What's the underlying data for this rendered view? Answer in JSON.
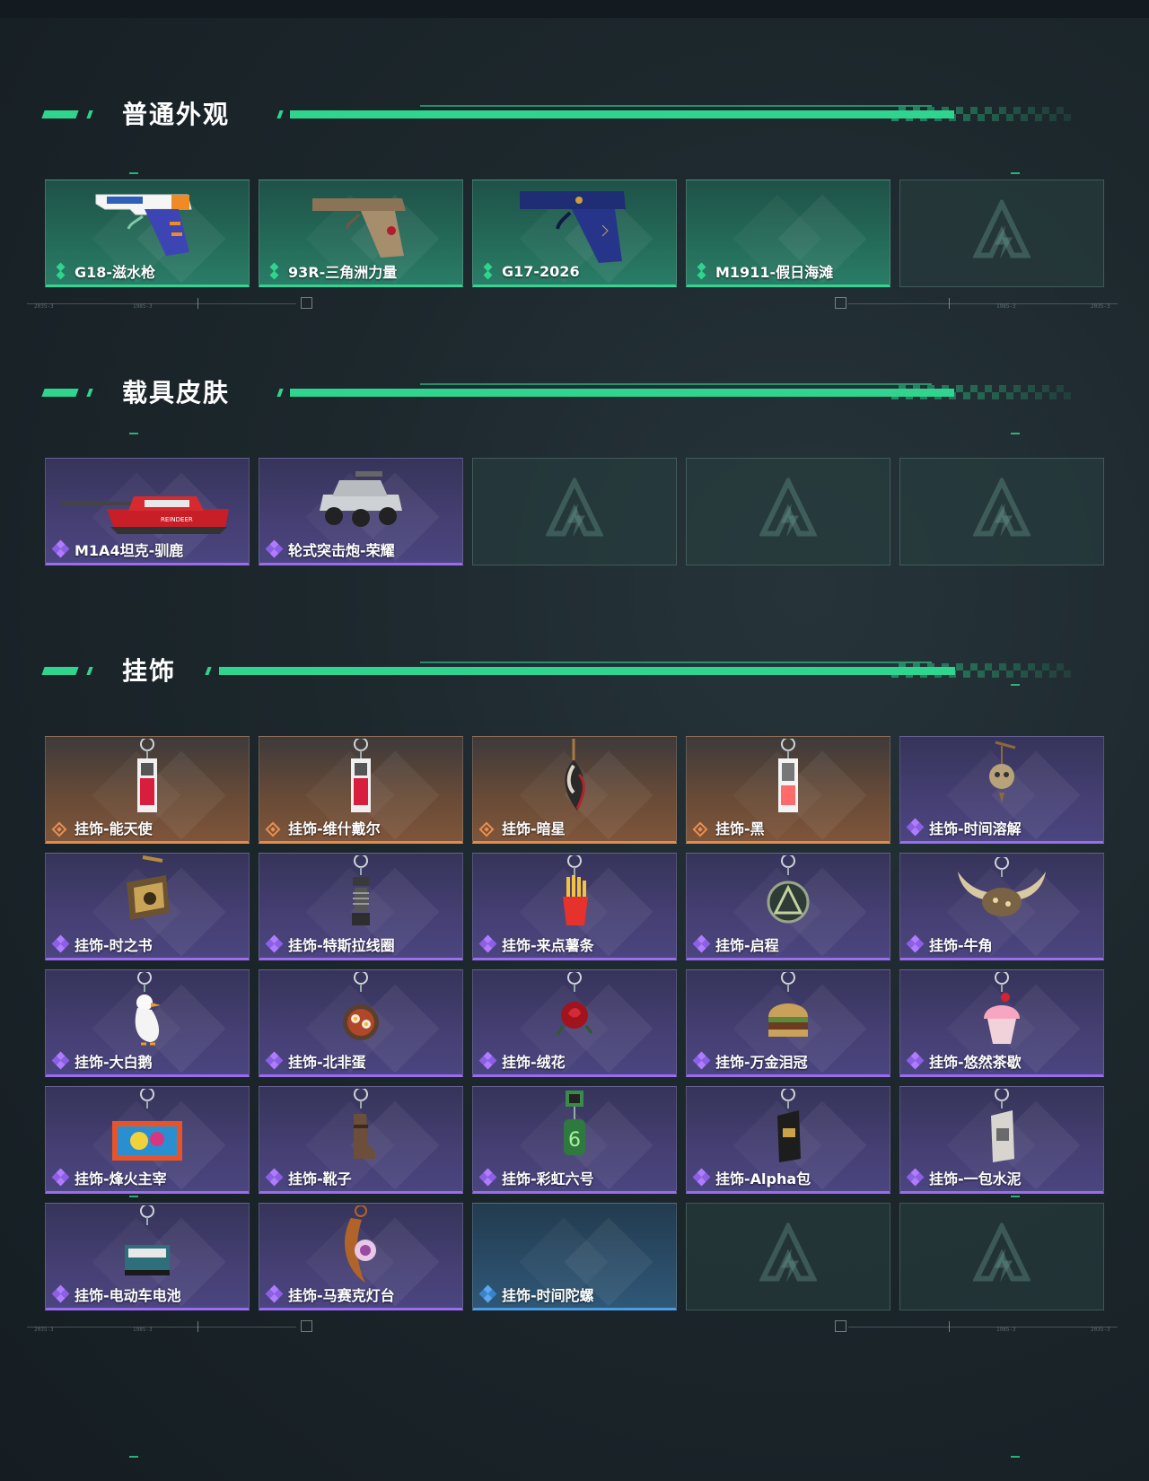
{
  "sections": [
    {
      "title": "普通外观",
      "cards": [
        {
          "label": "G18-滋水枪",
          "rarity": "green",
          "item": "pistol-orange"
        },
        {
          "label": "93R-三角洲力量",
          "rarity": "green",
          "item": "pistol-tan"
        },
        {
          "label": "G17-2026",
          "rarity": "green",
          "item": "pistol-navy"
        },
        {
          "label": "M1911-假日海滩",
          "rarity": "green",
          "item": "none"
        },
        {
          "label": "",
          "rarity": "empty",
          "item": "logo"
        }
      ]
    },
    {
      "title": "载具皮肤",
      "cards": [
        {
          "label": "M1A4坦克-驯鹿",
          "rarity": "purple",
          "item": "tank"
        },
        {
          "label": "轮式突击炮-荣耀",
          "rarity": "purple",
          "item": "armored-car"
        },
        {
          "label": "",
          "rarity": "empty",
          "item": "logo"
        },
        {
          "label": "",
          "rarity": "empty",
          "item": "logo"
        },
        {
          "label": "",
          "rarity": "empty",
          "item": "logo"
        }
      ]
    },
    {
      "title": "挂饰",
      "cards": [
        {
          "label": "挂饰-能天使",
          "rarity": "orange",
          "item": "charm-card-red"
        },
        {
          "label": "挂饰-维什戴尔",
          "rarity": "orange",
          "item": "charm-card-red"
        },
        {
          "label": "挂饰-暗星",
          "rarity": "orange",
          "item": "charm-feather"
        },
        {
          "label": "挂饰-黑",
          "rarity": "orange",
          "item": "charm-card-white"
        },
        {
          "label": "挂饰-时间溶解",
          "rarity": "purple",
          "item": "charm-skull"
        },
        {
          "label": "挂饰-时之书",
          "rarity": "purple",
          "item": "charm-book"
        },
        {
          "label": "挂饰-特斯拉线圈",
          "rarity": "purple",
          "item": "charm-coil"
        },
        {
          "label": "挂饰-来点薯条",
          "rarity": "purple",
          "item": "charm-fries"
        },
        {
          "label": "挂饰-启程",
          "rarity": "purple",
          "item": "charm-medal"
        },
        {
          "label": "挂饰-牛角",
          "rarity": "purple",
          "item": "charm-horns"
        },
        {
          "label": "挂饰-大白鹅",
          "rarity": "purple",
          "item": "charm-goose"
        },
        {
          "label": "挂饰-北非蛋",
          "rarity": "purple",
          "item": "charm-pan"
        },
        {
          "label": "挂饰-绒花",
          "rarity": "purple",
          "item": "charm-rose"
        },
        {
          "label": "挂饰-万金泪冠",
          "rarity": "purple",
          "item": "charm-burger"
        },
        {
          "label": "挂饰-悠然茶歇",
          "rarity": "purple",
          "item": "charm-cupcake"
        },
        {
          "label": "挂饰-烽火主宰",
          "rarity": "purple",
          "item": "charm-banner"
        },
        {
          "label": "挂饰-靴子",
          "rarity": "purple",
          "item": "charm-boot"
        },
        {
          "label": "挂饰-彩虹六号",
          "rarity": "purple",
          "item": "charm-six"
        },
        {
          "label": "挂饰-Alpha包",
          "rarity": "purple",
          "item": "charm-bag-dark"
        },
        {
          "label": "挂饰-一包水泥",
          "rarity": "purple",
          "item": "charm-bag-light"
        },
        {
          "label": "挂饰-电动车电池",
          "rarity": "purple",
          "item": "charm-battery"
        },
        {
          "label": "挂饰-马赛克灯台",
          "rarity": "purple",
          "item": "charm-lamp"
        },
        {
          "label": "挂饰-时间陀螺",
          "rarity": "blue",
          "item": "none"
        },
        {
          "label": "",
          "rarity": "empty",
          "item": "logo"
        },
        {
          "label": "",
          "rarity": "empty",
          "item": "logo"
        }
      ]
    }
  ],
  "colors": {
    "accent": "#2fd58f",
    "green_rarity": "#33d494",
    "purple_rarity": "#9a6cf0",
    "orange_rarity": "#e28c4b",
    "blue_rarity": "#4c9de4"
  }
}
